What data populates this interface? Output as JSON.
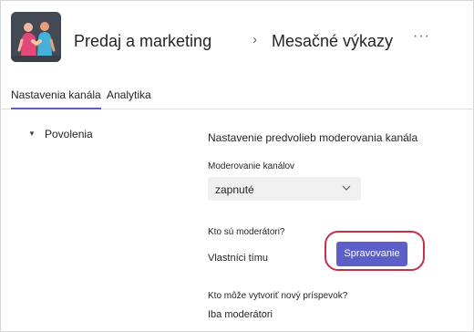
{
  "header": {
    "team_name": "Predaj a marketing",
    "separator": "›",
    "channel_name": "Mesačné výkazy",
    "more_label": "···"
  },
  "tabs": [
    {
      "label": "Nastavenia kanála",
      "active": true
    },
    {
      "label": "Analytika",
      "active": false
    }
  ],
  "permissions": {
    "section_label": "Povolenia",
    "setting_title": "Nastavenie predvolieb moderovania kanála",
    "moderation": {
      "label": "Moderovanie kanálov",
      "value": "zapnuté"
    },
    "moderators": {
      "label": "Kto sú moderátori?",
      "value": "Vlastníci tímu",
      "button_label": "Spravovanie"
    },
    "new_post": {
      "label": "Kto môže vytvoriť nový príspevok?",
      "value": "Iba moderátori"
    }
  },
  "colors": {
    "accent": "#5b5fc7",
    "highlight_ring": "#c4314b"
  },
  "icons": {
    "team_avatar": "team-avatar-people-handshake",
    "section_toggle": "triangle-down-icon",
    "dropdown_chevron": "chevron-down-icon"
  }
}
